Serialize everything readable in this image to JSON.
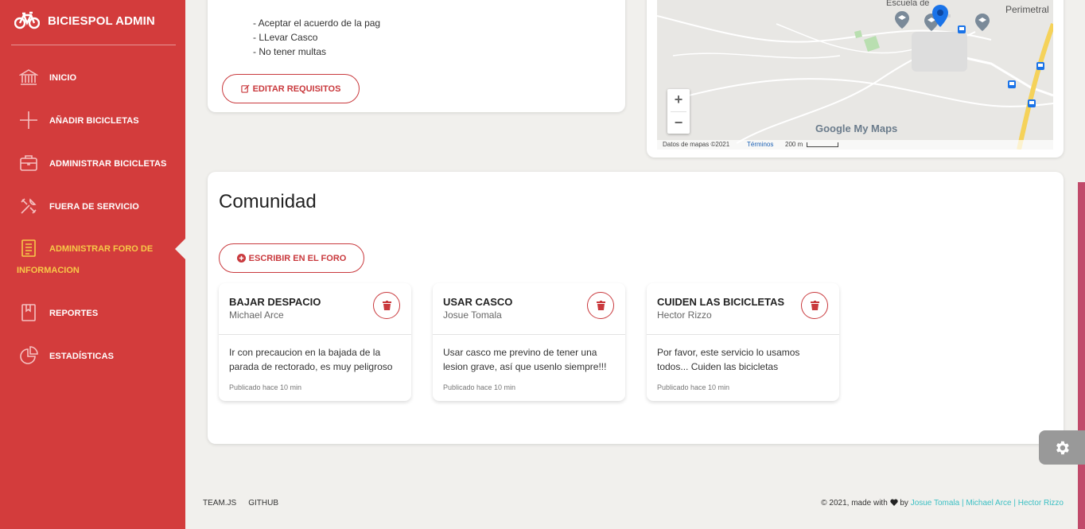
{
  "sidebar": {
    "brand": "BICIESPOL ADMIN",
    "items": [
      {
        "label": "INICIO",
        "icon": "bank-icon"
      },
      {
        "label": "AÑADIR BICICLETAS",
        "icon": "plus-icon"
      },
      {
        "label": "ADMINISTRAR BICICLETAS",
        "icon": "briefcase-icon"
      },
      {
        "label": "FUERA DE SERVICIO",
        "icon": "tools-icon"
      },
      {
        "label": "ADMINISTRAR FORO DE INFORMACION",
        "icon": "document-icon",
        "active": true
      },
      {
        "label": "REPORTES",
        "icon": "book-icon"
      },
      {
        "label": "ESTADÍSTICAS",
        "icon": "pie-chart-icon"
      }
    ],
    "active_color": "#f7c948",
    "bg_color": "#d33c3c"
  },
  "requirements": {
    "items": [
      "- Aceptar el acuerdo de la pag",
      "- LLevar Casco",
      "- No tener multas"
    ],
    "edit_button": "EDITAR REQUISITOS"
  },
  "map": {
    "labels": {
      "school": "Escuela de",
      "road": "Perimetral"
    },
    "zoom_in": "+",
    "zoom_out": "−",
    "brand": "Google My Maps",
    "data_credit": "Datos de mapas ©2021",
    "terms": "Términos",
    "scale": "200 m"
  },
  "forum": {
    "title": "Comunidad",
    "write_button": "ESCRIBIR EN EL FORO",
    "posts": [
      {
        "title": "BAJAR DESPACIO",
        "author": "Michael Arce",
        "body": "Ir con precaucion en la bajada de la parada de rectorado, es muy peligroso",
        "time": "Publicado hace 10 min"
      },
      {
        "title": "USAR CASCO",
        "author": "Josue Tomala",
        "body": "Usar casco me previno de tener una lesion grave, así que usenlo siempre!!!",
        "time": "Publicado hace 10 min"
      },
      {
        "title": "CUIDEN LAS BICICLETAS",
        "author": "Hector Rizzo",
        "body": "Por favor, este servicio lo usamos todos... Cuiden las bicicletas",
        "time": "Publicado hace 10 min"
      }
    ]
  },
  "footer": {
    "links": [
      "TEAM.JS",
      "GITHUB"
    ],
    "copyright": "© 2021, made with",
    "by": "by",
    "authors": "Josue Tomala | Michael Arce | Hector Rizzo"
  }
}
